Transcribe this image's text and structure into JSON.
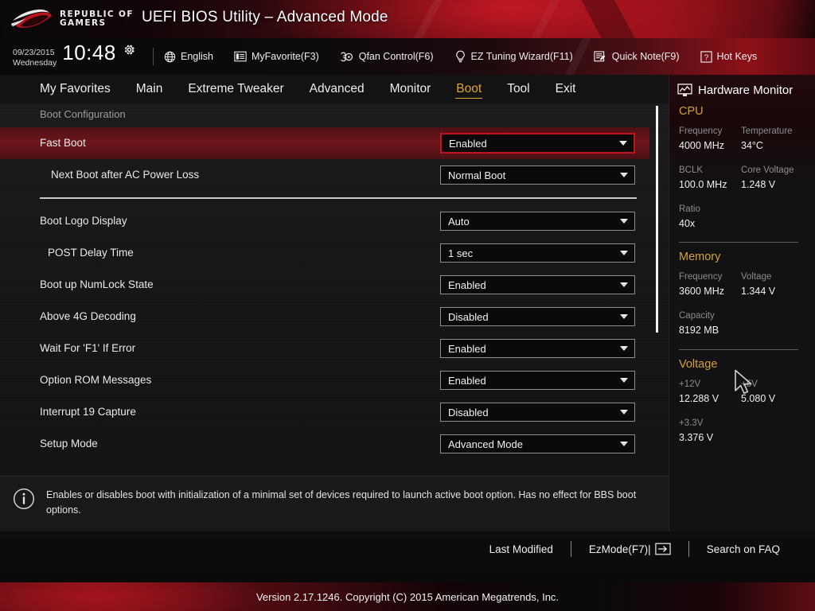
{
  "banner": {
    "brand_line1": "REPUBLIC OF",
    "brand_line2": "GAMERS",
    "title": "UEFI BIOS Utility – Advanced Mode",
    "accent_red": "#b5151f"
  },
  "toolstrip": {
    "date": "09/23/2015",
    "weekday": "Wednesday",
    "time": "10:48",
    "gear_icon": "gear-icon",
    "items": [
      {
        "label": "English",
        "icon": "globe-icon"
      },
      {
        "label": "MyFavorite(F3)",
        "icon": "list-icon"
      },
      {
        "label": "Qfan Control(F6)",
        "icon": "fan-icon"
      },
      {
        "label": "EZ Tuning Wizard(F11)",
        "icon": "bulb-icon"
      },
      {
        "label": "Quick Note(F9)",
        "icon": "note-pencil-icon"
      },
      {
        "label": "Hot Keys",
        "icon": "question-box-icon"
      }
    ]
  },
  "nav": {
    "active_color": "#e0a82e",
    "tabs": [
      {
        "label": "My Favorites",
        "active": false
      },
      {
        "label": "Main",
        "active": false
      },
      {
        "label": "Extreme Tweaker",
        "active": false
      },
      {
        "label": "Advanced",
        "active": false
      },
      {
        "label": "Monitor",
        "active": false
      },
      {
        "label": "Boot",
        "active": true
      },
      {
        "label": "Tool",
        "active": false
      },
      {
        "label": "Exit",
        "active": false
      }
    ]
  },
  "main": {
    "section_title": "Boot Configuration",
    "highlight_color": "#6d161b",
    "rows": [
      {
        "type": "setting",
        "label": "Fast Boot",
        "value": "Enabled",
        "selected": true,
        "indent": 0
      },
      {
        "type": "setting",
        "label": "Next Boot after AC Power Loss",
        "value": "Normal Boot",
        "selected": false,
        "indent": 1
      },
      {
        "type": "separator"
      },
      {
        "type": "setting",
        "label": "Boot Logo Display",
        "value": "Auto",
        "selected": false,
        "indent": 0
      },
      {
        "type": "setting",
        "label": "POST Delay Time",
        "value": "1 sec",
        "selected": false,
        "indent": 1
      },
      {
        "type": "setting",
        "label": "Boot up NumLock State",
        "value": "Enabled",
        "selected": false,
        "indent": 0
      },
      {
        "type": "setting",
        "label": "Above 4G Decoding",
        "value": "Disabled",
        "selected": false,
        "indent": 0
      },
      {
        "type": "setting",
        "label": "Wait For 'F1' If Error",
        "value": "Enabled",
        "selected": false,
        "indent": 0
      },
      {
        "type": "setting",
        "label": "Option ROM Messages",
        "value": "Enabled",
        "selected": false,
        "indent": 0
      },
      {
        "type": "setting",
        "label": "Interrupt 19 Capture",
        "value": "Disabled",
        "selected": false,
        "indent": 0
      },
      {
        "type": "setting",
        "label": "Setup Mode",
        "value": "Advanced Mode",
        "selected": false,
        "indent": 0
      }
    ]
  },
  "help": {
    "icon": "info-icon",
    "text": "Enables or disables boot with initialization of a minimal set of devices required to launch active boot option. Has no effect for BBS boot options."
  },
  "hardware_monitor": {
    "title": "Hardware Monitor",
    "title_icon": "monitor-icon",
    "section_color": "#d2a03a",
    "sections": [
      {
        "name": "CPU",
        "pairs": [
          [
            {
              "key": "Frequency",
              "value": "4000 MHz"
            },
            {
              "key": "Temperature",
              "value": "34°C"
            }
          ],
          [
            {
              "key": "BCLK",
              "value": "100.0 MHz"
            },
            {
              "key": "Core Voltage",
              "value": "1.248 V"
            }
          ],
          [
            {
              "key": "Ratio",
              "value": "40x"
            }
          ]
        ],
        "rule_after": true
      },
      {
        "name": "Memory",
        "pairs": [
          [
            {
              "key": "Frequency",
              "value": "3600 MHz"
            },
            {
              "key": "Voltage",
              "value": "1.344 V"
            }
          ],
          [
            {
              "key": "Capacity",
              "value": "8192 MB"
            }
          ]
        ],
        "rule_after": true
      },
      {
        "name": "Voltage",
        "pairs": [
          [
            {
              "key": "+12V",
              "value": "12.288 V"
            },
            {
              "key": "+5V",
              "value": "5.080 V"
            }
          ],
          [
            {
              "key": "+3.3V",
              "value": "3.376 V"
            }
          ]
        ],
        "rule_after": false
      }
    ]
  },
  "footer": {
    "links": [
      {
        "label": "Last Modified",
        "icon": null
      },
      {
        "label": "EzMode(F7)|",
        "icon": "arrow-right-box-icon"
      },
      {
        "label": "Search on FAQ",
        "icon": null
      }
    ],
    "version": "Version 2.17.1246. Copyright (C) 2015 American Megatrends, Inc."
  },
  "cursor": {
    "icon": "mouse-pointer-icon"
  }
}
